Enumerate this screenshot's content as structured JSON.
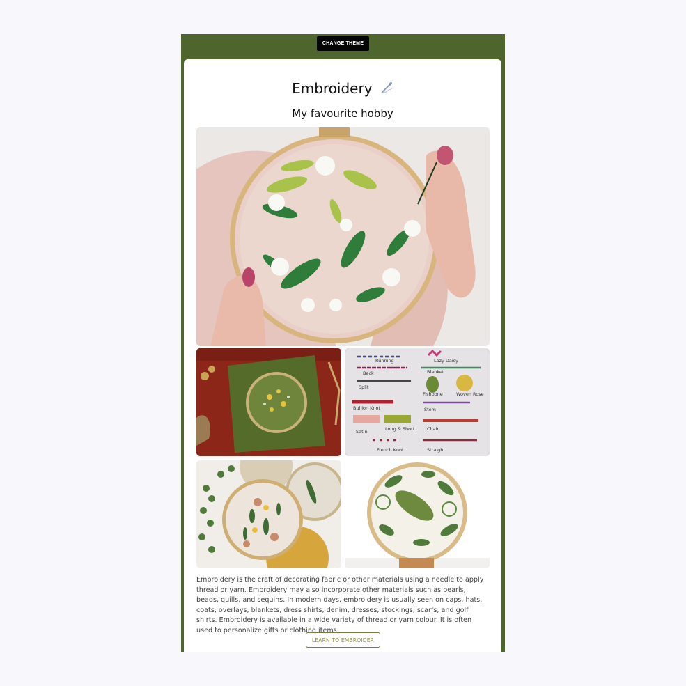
{
  "header": {
    "theme_button_label": "CHANGE THEME"
  },
  "page": {
    "title": "Embroidery",
    "subtitle": "My favourite hobby",
    "description": "Embroidery is the craft of decorating fabric or other materials using a needle to apply thread or yarn. Embroidery may also incorporate other materials such as pearls, beads, quills, and sequins. In modern days, embroidery is usually seen on caps, hats, coats, overlays, blankets, dress shirts, denim, dresses, stockings, scarfs, and golf shirts. Embroidery is available in a wide variety of thread or yarn colour. It is often used to personalize gifts or clothing items.",
    "learn_button_label": "LEARN TO EMBROIDER"
  },
  "stitch_sampler": {
    "labels": [
      "Running",
      "Lazy Daisy",
      "Back",
      "Blanket",
      "Split",
      "Fishbone",
      "Woven Rose",
      "Bullion Knot",
      "Stem",
      "Satin",
      "Long & Short",
      "Chain",
      "French Knot",
      "Straight"
    ]
  },
  "icons": {
    "title_icon": "needle-icon"
  },
  "colors": {
    "frame": "#4e662e",
    "page_bg": "#f7f7fc",
    "theme_button_bg": "#050505",
    "learn_button_text": "#8a8c40"
  }
}
